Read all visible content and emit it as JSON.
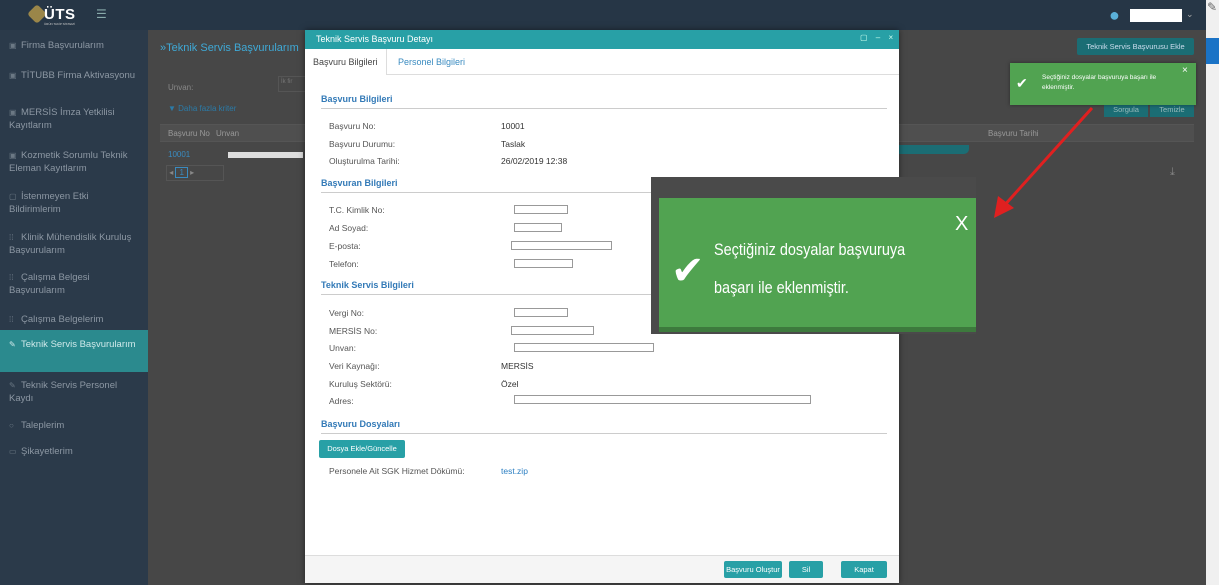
{
  "app": {
    "logo": "ÜTS",
    "logo_sub": "ÜRÜN TAKİP SİSTEMİ"
  },
  "header": {
    "add_button": "Teknik Servis Başvurusu Ekle",
    "user_caret": "⌄"
  },
  "sidebar": {
    "items": [
      {
        "label": "Firma Başvurularım",
        "icon": "document-icon"
      },
      {
        "label": "TİTUBB Firma Aktivasyonu",
        "icon": "document-icon"
      },
      {
        "label": "MERSİS İmza Yetkilisi Kayıtlarım",
        "icon": "document-icon"
      },
      {
        "label": "Kozmetik Sorumlu Teknik Eleman Kayıtlarım",
        "icon": "document-icon"
      },
      {
        "label": "İstenmeyen Etki Bildirimlerim",
        "icon": "chat-icon"
      },
      {
        "label": "Klinik Mühendislik Kuruluş Başvurularım",
        "icon": "grid-icon"
      },
      {
        "label": "Çalışma Belgesi Başvurularım",
        "icon": "grid-icon"
      },
      {
        "label": "Çalışma Belgelerim",
        "icon": "grid-icon"
      },
      {
        "label": "Teknik Servis Başvurularım",
        "icon": "wrench-icon"
      },
      {
        "label": "Teknik Servis Personel Kaydı",
        "icon": "pencil-icon"
      },
      {
        "label": "Taleplerim",
        "icon": "bubble-icon"
      },
      {
        "label": "Şikayetlerim",
        "icon": "message-icon"
      }
    ]
  },
  "main": {
    "title": "»Teknik Servis Başvurularım",
    "filter_label": "Unvan:",
    "filter_placeholder": "İk fir",
    "more_criteria": "▼ Daha fazla kriter",
    "search_button": "Sorgula",
    "clear_button": "Temizle",
    "columns": {
      "no": "Başvuru No",
      "unvan": "Unvan",
      "date": "Başvuru Tarihi"
    },
    "row_no": "10001",
    "page": "1"
  },
  "modal": {
    "title": "Teknik Servis Başvuru Detayı",
    "tabs": [
      "Başvuru Bilgileri",
      "Personel Bilgileri"
    ],
    "sections": {
      "basvuru": "Başvuru Bilgileri",
      "basvuran": "Başvuran Bilgileri",
      "teknik": "Teknik Servis Bilgileri",
      "dosyalar": "Başvuru Dosyaları"
    },
    "basvuru": {
      "no_label": "Başvuru No:",
      "no": "10001",
      "status_label": "Başvuru Durumu:",
      "status": "Taslak",
      "created_label": "Oluşturulma Tarihi:",
      "created": "26/02/2019 12:38"
    },
    "basvuran": {
      "tc_label": "T.C. Kimlik No:",
      "name_label": "Ad Soyad:",
      "email_label": "E-posta:",
      "phone_label": "Telefon:"
    },
    "teknik": {
      "vergi_label": "Vergi No:",
      "mersis_label": "MERSİS No:",
      "unvan_label": "Unvan:",
      "source_label": "Veri Kaynağı:",
      "source": "MERSİS",
      "sector_label": "Kuruluş Sektörü:",
      "sector": "Özel",
      "address_label": "Adres:"
    },
    "files": {
      "button": "Dosya Ekle/Güncelle",
      "label": "Personele Ait SGK Hizmet Dökümü:",
      "link": "test.zip"
    },
    "footer": {
      "create": "Başvuru Oluştur",
      "delete": "Sil",
      "close": "Kapat"
    }
  },
  "toast": {
    "message": "Seçtiğiniz dosyalar başvuruya başarı ile eklenmiştir.",
    "close": "×",
    "zoom_close": "X",
    "color": "#51a351"
  }
}
